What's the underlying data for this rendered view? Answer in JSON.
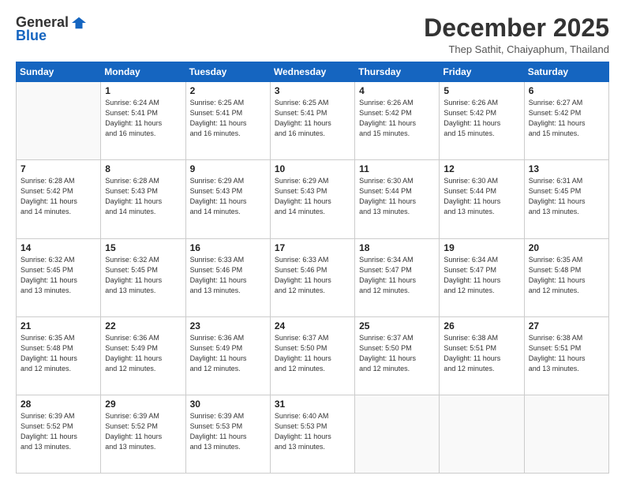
{
  "header": {
    "logo_general": "General",
    "logo_blue": "Blue",
    "month_title": "December 2025",
    "subtitle": "Thep Sathit, Chaiyaphum, Thailand"
  },
  "days_of_week": [
    "Sunday",
    "Monday",
    "Tuesday",
    "Wednesday",
    "Thursday",
    "Friday",
    "Saturday"
  ],
  "weeks": [
    [
      {
        "day": "",
        "info": ""
      },
      {
        "day": "1",
        "info": "Sunrise: 6:24 AM\nSunset: 5:41 PM\nDaylight: 11 hours\nand 16 minutes."
      },
      {
        "day": "2",
        "info": "Sunrise: 6:25 AM\nSunset: 5:41 PM\nDaylight: 11 hours\nand 16 minutes."
      },
      {
        "day": "3",
        "info": "Sunrise: 6:25 AM\nSunset: 5:41 PM\nDaylight: 11 hours\nand 16 minutes."
      },
      {
        "day": "4",
        "info": "Sunrise: 6:26 AM\nSunset: 5:42 PM\nDaylight: 11 hours\nand 15 minutes."
      },
      {
        "day": "5",
        "info": "Sunrise: 6:26 AM\nSunset: 5:42 PM\nDaylight: 11 hours\nand 15 minutes."
      },
      {
        "day": "6",
        "info": "Sunrise: 6:27 AM\nSunset: 5:42 PM\nDaylight: 11 hours\nand 15 minutes."
      }
    ],
    [
      {
        "day": "7",
        "info": "Sunrise: 6:28 AM\nSunset: 5:42 PM\nDaylight: 11 hours\nand 14 minutes."
      },
      {
        "day": "8",
        "info": "Sunrise: 6:28 AM\nSunset: 5:43 PM\nDaylight: 11 hours\nand 14 minutes."
      },
      {
        "day": "9",
        "info": "Sunrise: 6:29 AM\nSunset: 5:43 PM\nDaylight: 11 hours\nand 14 minutes."
      },
      {
        "day": "10",
        "info": "Sunrise: 6:29 AM\nSunset: 5:43 PM\nDaylight: 11 hours\nand 14 minutes."
      },
      {
        "day": "11",
        "info": "Sunrise: 6:30 AM\nSunset: 5:44 PM\nDaylight: 11 hours\nand 13 minutes."
      },
      {
        "day": "12",
        "info": "Sunrise: 6:30 AM\nSunset: 5:44 PM\nDaylight: 11 hours\nand 13 minutes."
      },
      {
        "day": "13",
        "info": "Sunrise: 6:31 AM\nSunset: 5:45 PM\nDaylight: 11 hours\nand 13 minutes."
      }
    ],
    [
      {
        "day": "14",
        "info": "Sunrise: 6:32 AM\nSunset: 5:45 PM\nDaylight: 11 hours\nand 13 minutes."
      },
      {
        "day": "15",
        "info": "Sunrise: 6:32 AM\nSunset: 5:45 PM\nDaylight: 11 hours\nand 13 minutes."
      },
      {
        "day": "16",
        "info": "Sunrise: 6:33 AM\nSunset: 5:46 PM\nDaylight: 11 hours\nand 13 minutes."
      },
      {
        "day": "17",
        "info": "Sunrise: 6:33 AM\nSunset: 5:46 PM\nDaylight: 11 hours\nand 12 minutes."
      },
      {
        "day": "18",
        "info": "Sunrise: 6:34 AM\nSunset: 5:47 PM\nDaylight: 11 hours\nand 12 minutes."
      },
      {
        "day": "19",
        "info": "Sunrise: 6:34 AM\nSunset: 5:47 PM\nDaylight: 11 hours\nand 12 minutes."
      },
      {
        "day": "20",
        "info": "Sunrise: 6:35 AM\nSunset: 5:48 PM\nDaylight: 11 hours\nand 12 minutes."
      }
    ],
    [
      {
        "day": "21",
        "info": "Sunrise: 6:35 AM\nSunset: 5:48 PM\nDaylight: 11 hours\nand 12 minutes."
      },
      {
        "day": "22",
        "info": "Sunrise: 6:36 AM\nSunset: 5:49 PM\nDaylight: 11 hours\nand 12 minutes."
      },
      {
        "day": "23",
        "info": "Sunrise: 6:36 AM\nSunset: 5:49 PM\nDaylight: 11 hours\nand 12 minutes."
      },
      {
        "day": "24",
        "info": "Sunrise: 6:37 AM\nSunset: 5:50 PM\nDaylight: 11 hours\nand 12 minutes."
      },
      {
        "day": "25",
        "info": "Sunrise: 6:37 AM\nSunset: 5:50 PM\nDaylight: 11 hours\nand 12 minutes."
      },
      {
        "day": "26",
        "info": "Sunrise: 6:38 AM\nSunset: 5:51 PM\nDaylight: 11 hours\nand 12 minutes."
      },
      {
        "day": "27",
        "info": "Sunrise: 6:38 AM\nSunset: 5:51 PM\nDaylight: 11 hours\nand 13 minutes."
      }
    ],
    [
      {
        "day": "28",
        "info": "Sunrise: 6:39 AM\nSunset: 5:52 PM\nDaylight: 11 hours\nand 13 minutes."
      },
      {
        "day": "29",
        "info": "Sunrise: 6:39 AM\nSunset: 5:52 PM\nDaylight: 11 hours\nand 13 minutes."
      },
      {
        "day": "30",
        "info": "Sunrise: 6:39 AM\nSunset: 5:53 PM\nDaylight: 11 hours\nand 13 minutes."
      },
      {
        "day": "31",
        "info": "Sunrise: 6:40 AM\nSunset: 5:53 PM\nDaylight: 11 hours\nand 13 minutes."
      },
      {
        "day": "",
        "info": ""
      },
      {
        "day": "",
        "info": ""
      },
      {
        "day": "",
        "info": ""
      }
    ]
  ]
}
